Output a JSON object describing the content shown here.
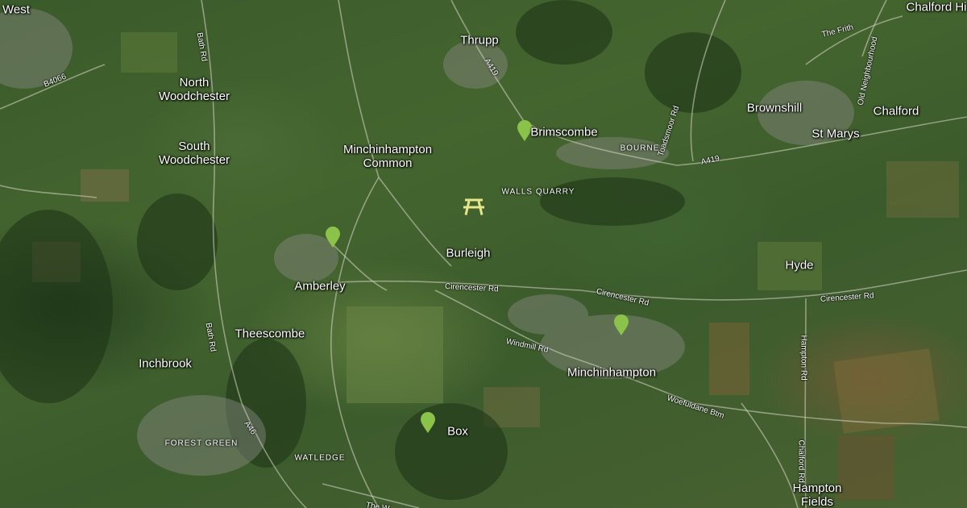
{
  "map": {
    "places": [
      {
        "id": "west",
        "name": "West"
      },
      {
        "id": "north-woodchester",
        "name": "North\nWoodchester"
      },
      {
        "id": "south-woodchester",
        "name": "South\nWoodchester"
      },
      {
        "id": "minchinhampton-common",
        "name": "Minchinhampton\nCommon"
      },
      {
        "id": "thrupp",
        "name": "Thrupp"
      },
      {
        "id": "brimscombe",
        "name": "Brimscombe"
      },
      {
        "id": "brownshill",
        "name": "Brownshill"
      },
      {
        "id": "chalford",
        "name": "Chalford"
      },
      {
        "id": "st-marys",
        "name": "St Marys"
      },
      {
        "id": "chalford-hill",
        "name": "Chalford Hi"
      },
      {
        "id": "burleigh",
        "name": "Burleigh"
      },
      {
        "id": "amberley",
        "name": "Amberley"
      },
      {
        "id": "theescombe",
        "name": "Theescombe"
      },
      {
        "id": "inchbrook",
        "name": "Inchbrook"
      },
      {
        "id": "minchinhampton",
        "name": "Minchinhampton"
      },
      {
        "id": "box",
        "name": "Box"
      },
      {
        "id": "hyde",
        "name": "Hyde"
      },
      {
        "id": "hampton-fields",
        "name": "Hampton\nFields"
      }
    ],
    "districts": [
      {
        "id": "bourne",
        "name": "BOURNE"
      },
      {
        "id": "walls-quarry",
        "name": "WALLS QUARRY"
      },
      {
        "id": "forest-green",
        "name": "FOREST GREEN"
      },
      {
        "id": "watledge",
        "name": "WATLEDGE"
      }
    ],
    "roads": [
      {
        "id": "b4066",
        "name": "B4066"
      },
      {
        "id": "bath-rd-north",
        "name": "Bath Rd"
      },
      {
        "id": "bath-rd-south",
        "name": "Bath Rd"
      },
      {
        "id": "a419-north",
        "name": "A419"
      },
      {
        "id": "a419-east",
        "name": "A419"
      },
      {
        "id": "toadsmoor-rd",
        "name": "Toadsmoor Rd"
      },
      {
        "id": "the-frith",
        "name": "The Frith"
      },
      {
        "id": "old-neighbourhood",
        "name": "Old Neighbourhood"
      },
      {
        "id": "cirencester-rd-west",
        "name": "Cirencester Rd"
      },
      {
        "id": "cirencester-rd-mid",
        "name": "Cirencester Rd"
      },
      {
        "id": "cirencester-rd-east",
        "name": "Cirencester Rd"
      },
      {
        "id": "windmill-rd",
        "name": "Windmill Rd"
      },
      {
        "id": "woefuldane-btm",
        "name": "Woefuldane Btm"
      },
      {
        "id": "hampton-rd",
        "name": "Hampton Rd"
      },
      {
        "id": "chalford-rd",
        "name": "Chalford Rd"
      },
      {
        "id": "a46",
        "name": "A46"
      },
      {
        "id": "the-w",
        "name": "The W"
      }
    ],
    "markers": [
      {
        "id": "marker-brimscombe",
        "color": "#8bc34a"
      },
      {
        "id": "marker-amberley",
        "color": "#8bc34a"
      },
      {
        "id": "marker-minchinhampton",
        "color": "#8bc34a"
      },
      {
        "id": "marker-box",
        "color": "#8bc34a"
      }
    ],
    "poi": {
      "icon": "picnic-table-icon",
      "color": "#e6e68a"
    },
    "base": "satellite"
  }
}
